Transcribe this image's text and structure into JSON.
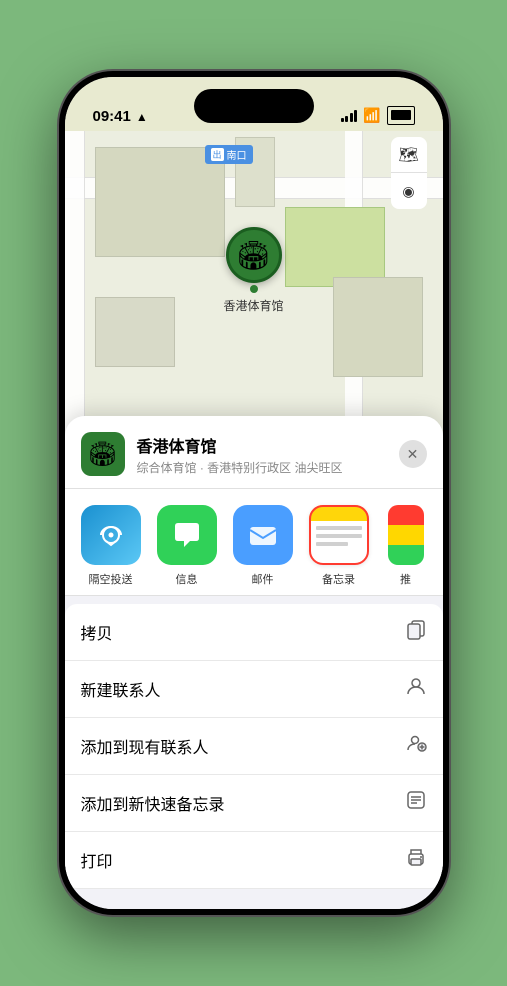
{
  "statusBar": {
    "time": "09:41",
    "locationArrow": "▲"
  },
  "map": {
    "label": "南口",
    "labelPrefix": "出",
    "stadiumEmoji": "🏟",
    "venueName": "香港体育馆",
    "mapIcon": "🗺"
  },
  "venueCard": {
    "name": "香港体育馆",
    "subtitle": "综合体育馆 · 香港特别行政区 油尖旺区",
    "icon": "🏟"
  },
  "shareItems": [
    {
      "id": "airdrop",
      "label": "隔空投送"
    },
    {
      "id": "messages",
      "label": "信息"
    },
    {
      "id": "mail",
      "label": "邮件"
    },
    {
      "id": "notes",
      "label": "备忘录"
    }
  ],
  "actionItems": [
    {
      "label": "拷贝",
      "iconUnicode": "⧉"
    },
    {
      "label": "新建联系人",
      "iconUnicode": "👤"
    },
    {
      "label": "添加到现有联系人",
      "iconUnicode": "👤"
    },
    {
      "label": "添加到新快速备忘录",
      "iconUnicode": "▤"
    },
    {
      "label": "打印",
      "iconUnicode": "🖨"
    }
  ],
  "closeBtn": "✕"
}
